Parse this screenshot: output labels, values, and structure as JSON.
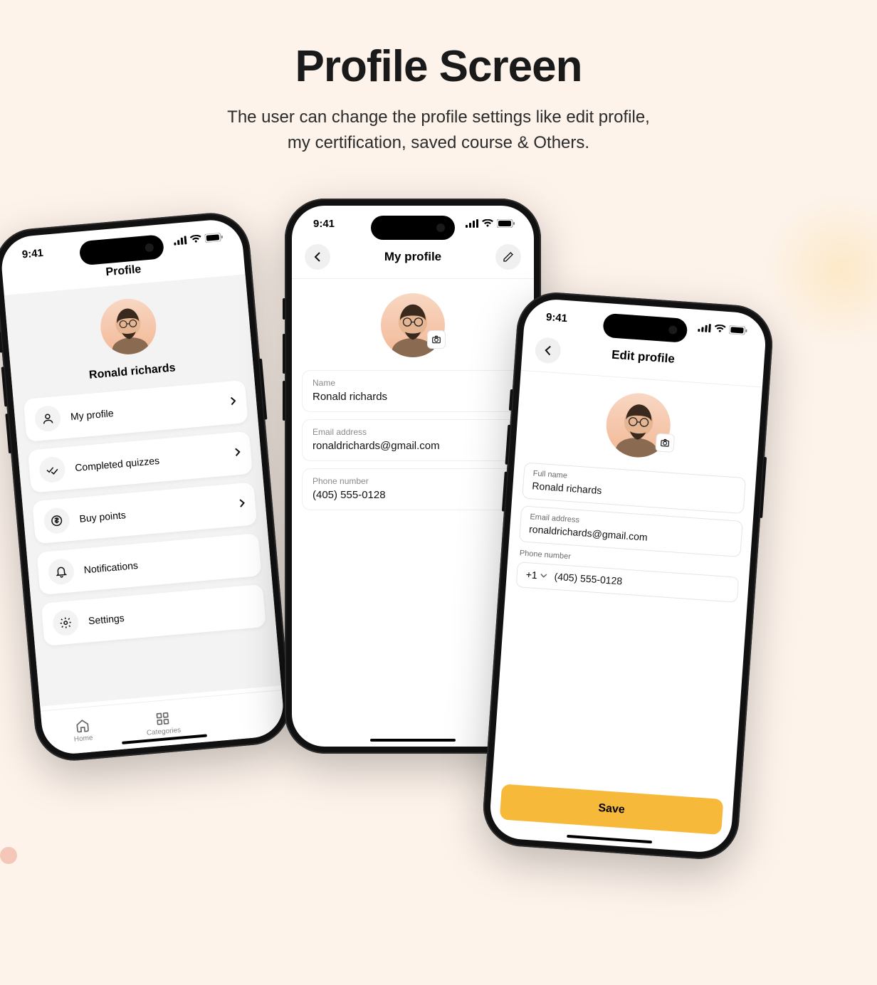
{
  "header": {
    "title": "Profile Screen",
    "subtitle_line1": "The user can change the profile settings like edit profile,",
    "subtitle_line2": "my certification, saved course & Others."
  },
  "status": {
    "time": "9:41"
  },
  "screen1": {
    "title": "Profile",
    "user_name": "Ronald richards",
    "menu": [
      {
        "label": "My profile",
        "icon": "person-icon"
      },
      {
        "label": "Completed quizzes",
        "icon": "check-all-icon"
      },
      {
        "label": "Buy points",
        "icon": "coin-icon"
      },
      {
        "label": "Notifications",
        "icon": "bell-icon"
      },
      {
        "label": "Settings",
        "icon": "gear-icon"
      }
    ],
    "tabs": {
      "home": "Home",
      "categories": "Categories"
    }
  },
  "screen2": {
    "title": "My profile",
    "fields": {
      "name_label": "Name",
      "name_value": "Ronald richards",
      "email_label": "Email address",
      "email_value": "ronaldrichards@gmail.com",
      "phone_label": "Phone number",
      "phone_value": "(405) 555-0128"
    }
  },
  "screen3": {
    "title": "Edit profile",
    "inputs": {
      "fullname_label": "Full name",
      "fullname_value": "Ronald richards",
      "email_label": "Email address",
      "email_value": "ronaldrichards@gmail.com",
      "phone_label": "Phone number",
      "country_code": "+1",
      "phone_value": "(405) 555-0128"
    },
    "save_label": "Save"
  }
}
